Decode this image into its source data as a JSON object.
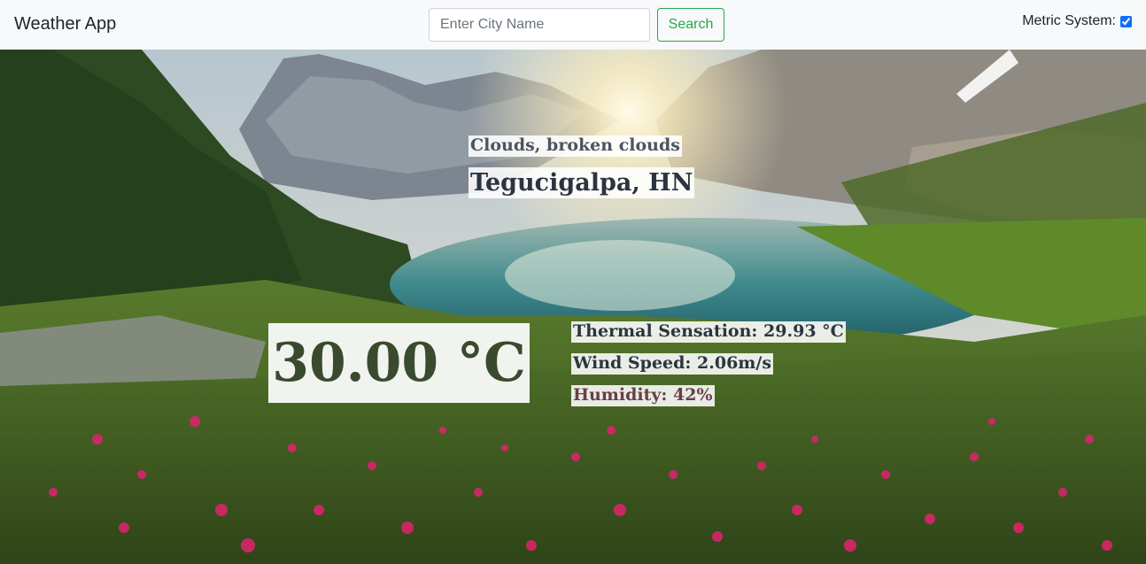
{
  "navbar": {
    "brand": "Weather App",
    "search": {
      "placeholder": "Enter City Name",
      "value": "",
      "button_label": "Search"
    },
    "metric": {
      "label": "Metric System:",
      "checked": true
    }
  },
  "weather": {
    "condition": "Clouds, broken clouds",
    "location": "Tegucigalpa, HN",
    "temperature": "30.00 °C",
    "thermal_sensation": "Thermal Sensation: 29.93 °C",
    "wind_speed": "Wind Speed: 2.06m/s",
    "humidity": "Humidity: 42%"
  },
  "colors": {
    "accent_green": "#28a745",
    "navbar_bg": "#f8f9fa"
  }
}
